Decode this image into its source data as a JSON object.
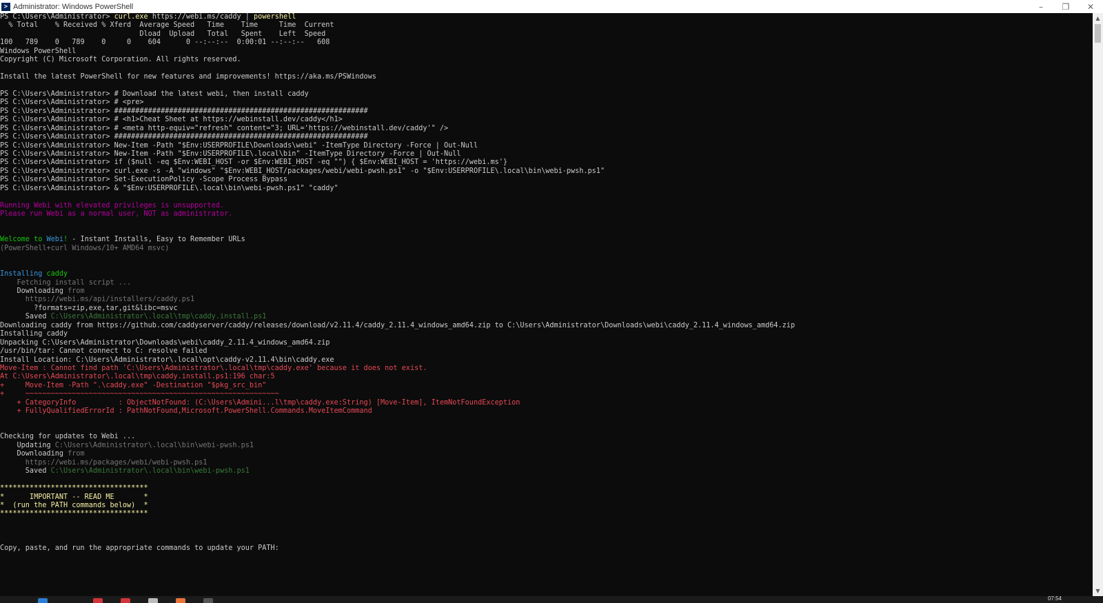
{
  "window": {
    "title": "Administrator: Windows PowerShell",
    "icon": "powershell-icon",
    "controls": {
      "minimize": "–",
      "maximize": "❐",
      "close": "✕"
    }
  },
  "colors": {
    "background": "#0c0c0c",
    "default_text": "#cccccc",
    "command_yellow": "#f9f1a5",
    "dim_gray": "#76767a",
    "path_green": "#3a7a3a",
    "warning_magenta": "#b4009e",
    "error_red": "#e74856",
    "welcome_green": "#16c60c",
    "webi_cyan": "#3a96dd"
  },
  "terminal": {
    "lines": [
      [
        {
          "c": "w",
          "t": "PS C:\\Users\\Administrator> "
        },
        {
          "c": "y",
          "t": "curl.exe"
        },
        {
          "c": "w",
          "t": " https://webi.ms/caddy | "
        },
        {
          "c": "y",
          "t": "powershell"
        }
      ],
      [
        {
          "c": "w",
          "t": "  % Total    % Received % Xferd  Average Speed   Time    Time     Time  Current"
        }
      ],
      [
        {
          "c": "w",
          "t": "                                 Dload  Upload   Total   Spent    Left  Speed"
        }
      ],
      [
        {
          "c": "w",
          "t": "100   789    0   789    0     0    604      0 --:--:--  0:00:01 --:--:--   608"
        }
      ],
      [
        {
          "c": "w",
          "t": "Windows PowerShell"
        }
      ],
      [
        {
          "c": "w",
          "t": "Copyright (C) Microsoft Corporation. All rights reserved."
        }
      ],
      [],
      [
        {
          "c": "w",
          "t": "Install the latest PowerShell for new features and improvements! https://aka.ms/PSWindows"
        }
      ],
      [],
      [
        {
          "c": "w",
          "t": "PS C:\\Users\\Administrator> # Download the latest webi, then install caddy"
        }
      ],
      [
        {
          "c": "w",
          "t": "PS C:\\Users\\Administrator> # <pre>"
        }
      ],
      [
        {
          "c": "w",
          "t": "PS C:\\Users\\Administrator> ############################################################"
        }
      ],
      [
        {
          "c": "w",
          "t": "PS C:\\Users\\Administrator> # <h1>Cheat Sheet at https://webinstall.dev/caddy</h1>"
        }
      ],
      [
        {
          "c": "w",
          "t": "PS C:\\Users\\Administrator> # <meta http-equiv=\"refresh\" content=\"3; URL='https://webinstall.dev/caddy'\" />"
        }
      ],
      [
        {
          "c": "w",
          "t": "PS C:\\Users\\Administrator> ############################################################"
        }
      ],
      [
        {
          "c": "w",
          "t": "PS C:\\Users\\Administrator> New-Item -Path \"$Env:USERPROFILE\\Downloads\\webi\" -ItemType Directory -Force | Out-Null"
        }
      ],
      [
        {
          "c": "w",
          "t": "PS C:\\Users\\Administrator> New-Item -Path \"$Env:USERPROFILE\\.local\\bin\" -ItemType Directory -Force | Out-Null"
        }
      ],
      [
        {
          "c": "w",
          "t": "PS C:\\Users\\Administrator> if ($null -eq $Env:WEBI_HOST -or $Env:WEBI_HOST -eq \"\") { $Env:WEBI_HOST = 'https://webi.ms'}"
        }
      ],
      [
        {
          "c": "w",
          "t": "PS C:\\Users\\Administrator> curl.exe -s -A \"windows\" \"$Env:WEBI_HOST/packages/webi/webi-pwsh.ps1\" -o \"$Env:USERPROFILE\\.local\\bin\\webi-pwsh.ps1\""
        }
      ],
      [
        {
          "c": "w",
          "t": "PS C:\\Users\\Administrator> Set-ExecutionPolicy -Scope Process Bypass"
        }
      ],
      [
        {
          "c": "w",
          "t": "PS C:\\Users\\Administrator> & \"$Env:USERPROFILE\\.local\\bin\\webi-pwsh.ps1\" \"caddy\""
        }
      ],
      [],
      [
        {
          "c": "m",
          "t": "Running Webi with elevated privileges is unsupported."
        }
      ],
      [
        {
          "c": "m",
          "t": "Please run Webi as a normal user, NOT as administrator."
        }
      ],
      [],
      [],
      [
        {
          "c": "gr",
          "t": "Welcome to "
        },
        {
          "c": "c",
          "t": "Webi"
        },
        {
          "c": "gr",
          "t": "!"
        },
        {
          "c": "w",
          "t": " - Instant Installs, Easy to Remember URLs"
        }
      ],
      [
        {
          "c": "g",
          "t": "(PowerShell+curl Windows/10+ AMD64 msvc)"
        }
      ],
      [],
      [],
      [
        {
          "c": "c",
          "t": "Installing "
        },
        {
          "c": "gr",
          "t": "caddy"
        }
      ],
      [
        {
          "c": "g",
          "t": "    Fetching install script ..."
        }
      ],
      [
        {
          "c": "w",
          "t": "    Downloading "
        },
        {
          "c": "g",
          "t": "from"
        }
      ],
      [
        {
          "c": "g",
          "t": "      https://webi.ms/api/installers/caddy.ps1"
        }
      ],
      [
        {
          "c": "w",
          "t": "        ?formats=zip,exe,tar,git&libc=msvc"
        }
      ],
      [
        {
          "c": "w",
          "t": "      Saved "
        },
        {
          "c": "dg",
          "t": "C:\\Users\\Administrator\\.local\\tmp\\caddy.install.ps1"
        }
      ],
      [
        {
          "c": "w",
          "t": "Downloading caddy from https://github.com/caddyserver/caddy/releases/download/v2.11.4/caddy_2.11.4_windows_amd64.zip to C:\\Users\\Administrator\\Downloads\\webi\\caddy_2.11.4_windows_amd64.zip"
        }
      ],
      [
        {
          "c": "w",
          "t": "Installing caddy"
        }
      ],
      [
        {
          "c": "w",
          "t": "Unpacking C:\\Users\\Administrator\\Downloads\\webi\\caddy_2.11.4_windows_amd64.zip"
        }
      ],
      [
        {
          "c": "w",
          "t": "/usr/bin/tar: Cannot connect to C: resolve failed"
        }
      ],
      [
        {
          "c": "w",
          "t": "Install Location: C:\\Users\\Administrator\\.local\\opt\\caddy-v2.11.4\\bin\\caddy.exe"
        }
      ],
      [
        {
          "c": "r",
          "t": "Move-Item : Cannot find path 'C:\\Users\\Administrator\\.local\\tmp\\caddy.exe' because it does not exist."
        }
      ],
      [
        {
          "c": "r",
          "t": "At C:\\Users\\Administrator\\.local\\tmp\\caddy.install.ps1:196 char:5"
        }
      ],
      [
        {
          "c": "r",
          "t": "+     Move-Item -Path \".\\caddy.exe\" -Destination \"$pkg_src_bin\""
        }
      ],
      [
        {
          "c": "r",
          "t": "+     ~~~~~~~~~~~~~~~~~~~~~~~~~~~~~~~~~~~~~~~~~~~~~~~~~~~~~~~~~~~~"
        }
      ],
      [
        {
          "c": "r",
          "t": "    + CategoryInfo          : ObjectNotFound: (C:\\Users\\Admini...l\\tmp\\caddy.exe:String) [Move-Item], ItemNotFoundException"
        }
      ],
      [
        {
          "c": "r",
          "t": "    + FullyQualifiedErrorId : PathNotFound,Microsoft.PowerShell.Commands.MoveItemCommand"
        }
      ],
      [],
      [],
      [
        {
          "c": "w",
          "t": "Checking for updates to Webi ..."
        }
      ],
      [
        {
          "c": "w",
          "t": "    Updating "
        },
        {
          "c": "g",
          "t": "C:\\Users\\Administrator\\.local\\bin\\webi-pwsh.ps1"
        }
      ],
      [
        {
          "c": "w",
          "t": "    Downloading "
        },
        {
          "c": "g",
          "t": "from"
        }
      ],
      [
        {
          "c": "g",
          "t": "      https://webi.ms/packages/webi/webi-pwsh.ps1"
        }
      ],
      [
        {
          "c": "w",
          "t": "      Saved "
        },
        {
          "c": "dg",
          "t": "C:\\Users\\Administrator\\.local\\bin\\webi-pwsh.ps1"
        }
      ],
      [],
      [
        {
          "c": "by",
          "t": "***********************************"
        }
      ],
      [
        {
          "c": "by",
          "t": "*      IMPORTANT -- READ ME       *"
        }
      ],
      [
        {
          "c": "by",
          "t": "*  (run the PATH commands below)  *"
        }
      ],
      [
        {
          "c": "by",
          "t": "***********************************"
        }
      ],
      [],
      [],
      [],
      [
        {
          "c": "w",
          "t": "Copy, paste, and run the appropriate commands to update your PATH:"
        }
      ]
    ]
  },
  "taskbar": {
    "clock": "07:54"
  }
}
